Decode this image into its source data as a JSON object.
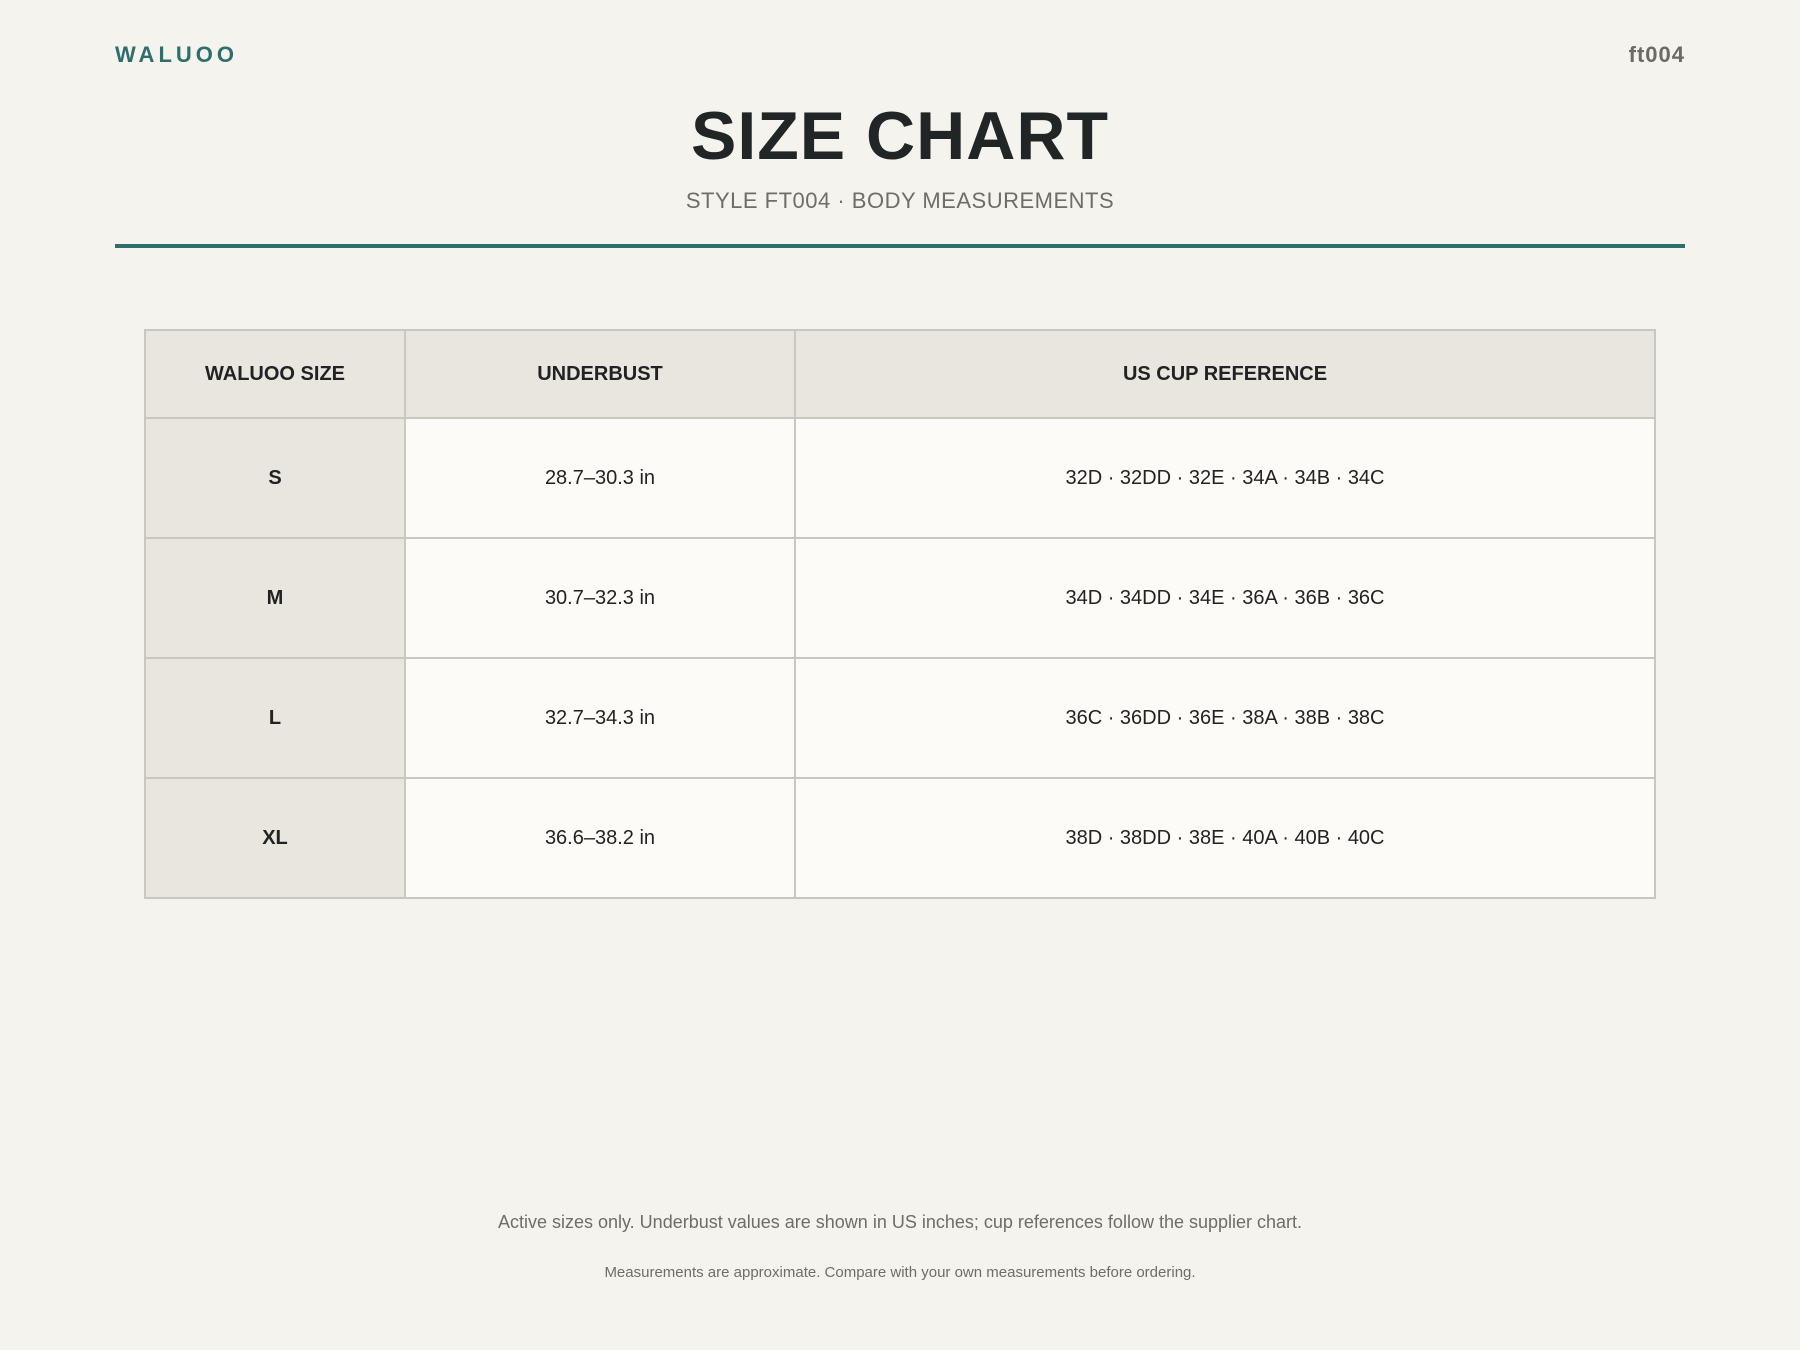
{
  "header": {
    "brand": "WALUOO",
    "style_code": "ft004",
    "title": "SIZE CHART",
    "subtitle": "STYLE FT004 · BODY MEASUREMENTS"
  },
  "table": {
    "columns": [
      "WALUOO SIZE",
      "UNDERBUST",
      "US CUP REFERENCE"
    ],
    "rows": [
      {
        "size": "S",
        "underbust": "28.7–30.3 in",
        "cups": "32D · 32DD · 32E · 34A · 34B · 34C"
      },
      {
        "size": "M",
        "underbust": "30.7–32.3 in",
        "cups": "34D · 34DD · 34E · 36A · 36B · 36C"
      },
      {
        "size": "L",
        "underbust": "32.7–34.3 in",
        "cups": "36C · 36DD · 36E · 38A · 38B · 38C"
      },
      {
        "size": "XL",
        "underbust": "36.6–38.2 in",
        "cups": "38D · 38DD · 38E · 40A · 40B · 40C"
      }
    ]
  },
  "footer": {
    "note": "Active sizes only. Underbust values are shown in US inches; cup references follow the supplier chart.",
    "disclaimer": "Measurements are approximate. Compare with your own measurements before ordering."
  },
  "colors": {
    "accent": "#2e6f6c",
    "background": "#f4f3ee",
    "header_cell": "#e9e6e0",
    "body_cell": "#fcfbf8",
    "border": "#c8c7c2"
  }
}
